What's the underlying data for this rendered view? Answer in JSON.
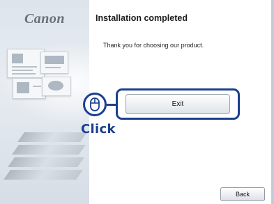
{
  "brand": {
    "logo_text": "Canon"
  },
  "dialog": {
    "title": "Installation completed",
    "message": "Thank you for choosing our product."
  },
  "buttons": {
    "exit_label": "Exit",
    "back_label": "Back"
  },
  "callout": {
    "click_label": "Click",
    "color": "#1b3f8f",
    "icon": "mouse-icon"
  }
}
